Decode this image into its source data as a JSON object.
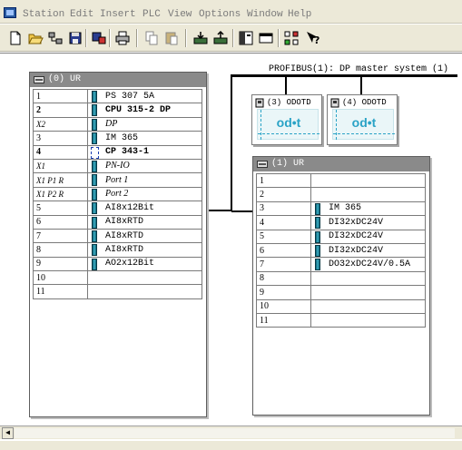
{
  "menu": [
    "Station",
    "Edit",
    "Insert",
    "PLC",
    "View",
    "Options",
    "Window",
    "Help"
  ],
  "toolbar_icons": [
    "new-icon",
    "open-icon",
    "accessible-nodes-icon",
    "save-icon",
    "save-compile-icon",
    "print-icon",
    "copy-icon",
    "paste-icon",
    "download-icon",
    "upload-icon",
    "catalog-icon",
    "overview-icon",
    "network-icon",
    "help-icon"
  ],
  "rack0": {
    "title": "(0) UR",
    "slots": [
      {
        "num": "1",
        "module": "PS 307 5A",
        "icon": "module"
      },
      {
        "num": "2",
        "module": "CPU 315-2 DP",
        "icon": "module",
        "bold": true
      },
      {
        "num": "X2",
        "module": "DP",
        "icon": "module",
        "italic": true
      },
      {
        "num": "3",
        "module": "IM 365",
        "icon": "module"
      },
      {
        "num": "4",
        "module": "CP 343-1",
        "icon": "net",
        "bold": true
      },
      {
        "num": "X1",
        "module": "PN-IO",
        "icon": "module",
        "italic": true
      },
      {
        "num": "X1 P1 R",
        "module": "Port 1",
        "icon": "module",
        "italic": true
      },
      {
        "num": "X1 P2 R",
        "module": "Port 2",
        "icon": "module",
        "italic": true
      },
      {
        "num": "5",
        "module": "AI8x12Bit",
        "icon": "module"
      },
      {
        "num": "6",
        "module": "AI8xRTD",
        "icon": "module"
      },
      {
        "num": "7",
        "module": "AI8xRTD",
        "icon": "module"
      },
      {
        "num": "8",
        "module": "AI8xRTD",
        "icon": "module"
      },
      {
        "num": "9",
        "module": "AO2x12Bit",
        "icon": "module"
      },
      {
        "num": "10",
        "module": "",
        "icon": ""
      },
      {
        "num": "11",
        "module": "",
        "icon": ""
      }
    ]
  },
  "rack1": {
    "title": "(1) UR",
    "slots": [
      {
        "num": "1",
        "module": "",
        "icon": ""
      },
      {
        "num": "2",
        "module": "",
        "icon": ""
      },
      {
        "num": "3",
        "module": "IM 365",
        "icon": "module"
      },
      {
        "num": "4",
        "module": "DI32xDC24V",
        "icon": "module"
      },
      {
        "num": "5",
        "module": "DI32xDC24V",
        "icon": "module"
      },
      {
        "num": "6",
        "module": "DI32xDC24V",
        "icon": "module"
      },
      {
        "num": "7",
        "module": "DO32xDC24V/0.5A",
        "icon": "module"
      },
      {
        "num": "8",
        "module": "",
        "icon": ""
      },
      {
        "num": "9",
        "module": "",
        "icon": ""
      },
      {
        "num": "10",
        "module": "",
        "icon": ""
      },
      {
        "num": "11",
        "module": "",
        "icon": ""
      }
    ]
  },
  "profibus": {
    "label": "PROFIBUS(1): DP master system (1)"
  },
  "dp_slaves": [
    {
      "label": "(3) ODOTD",
      "logo": "od•t"
    },
    {
      "label": "(4) ODOTD",
      "logo": "od•t"
    }
  ],
  "colors": {
    "accent": "#2aa3c6",
    "module": "#1a7f96",
    "rack_header": "#8a8a8a"
  }
}
